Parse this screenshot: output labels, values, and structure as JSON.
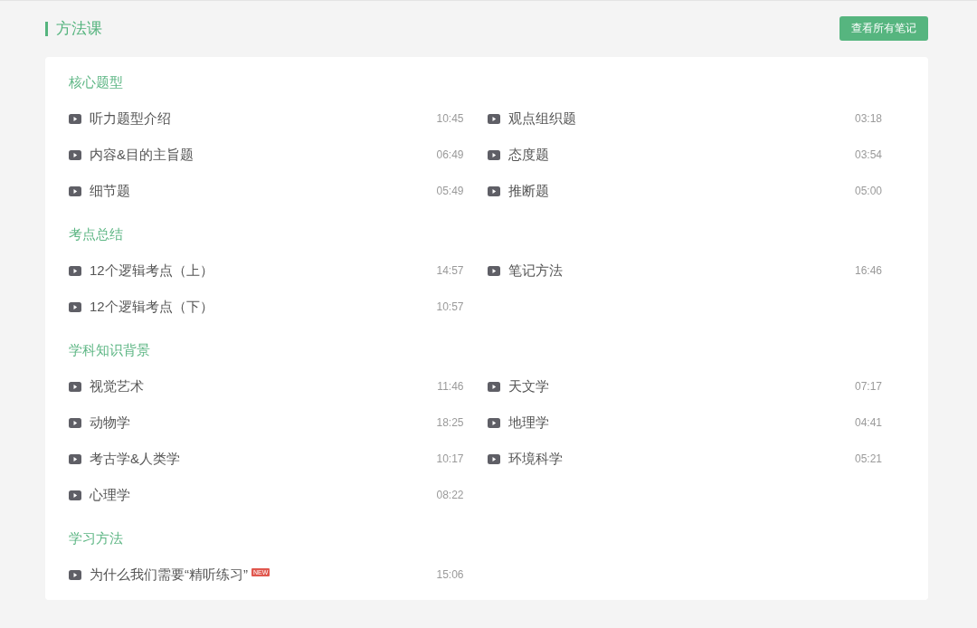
{
  "header": {
    "title": "方法课",
    "button": "查看所有笔记"
  },
  "sections": [
    {
      "title": "核心题型",
      "lessons": [
        {
          "title": "听力题型介绍",
          "duration": "10:45"
        },
        {
          "title": "观点组织题",
          "duration": "03:18"
        },
        {
          "title": "内容&目的主旨题",
          "duration": "06:49"
        },
        {
          "title": "态度题",
          "duration": "03:54"
        },
        {
          "title": "细节题",
          "duration": "05:49"
        },
        {
          "title": "推断题",
          "duration": "05:00"
        }
      ]
    },
    {
      "title": "考点总结",
      "lessons": [
        {
          "title": "12个逻辑考点（上）",
          "duration": "14:57"
        },
        {
          "title": "笔记方法",
          "duration": "16:46"
        },
        {
          "title": "12个逻辑考点（下）",
          "duration": "10:57"
        }
      ]
    },
    {
      "title": "学科知识背景",
      "lessons": [
        {
          "title": "视觉艺术",
          "duration": "11:46"
        },
        {
          "title": "天文学",
          "duration": "07:17"
        },
        {
          "title": "动物学",
          "duration": "18:25"
        },
        {
          "title": "地理学",
          "duration": "04:41"
        },
        {
          "title": "考古学&人类学",
          "duration": "10:17"
        },
        {
          "title": "环境科学",
          "duration": "05:21"
        },
        {
          "title": "心理学",
          "duration": "08:22"
        }
      ]
    },
    {
      "title": "学习方法",
      "lessons": [
        {
          "title": "为什么我们需要“精听练习”",
          "duration": "15:06",
          "badge": "NEW"
        }
      ]
    }
  ]
}
